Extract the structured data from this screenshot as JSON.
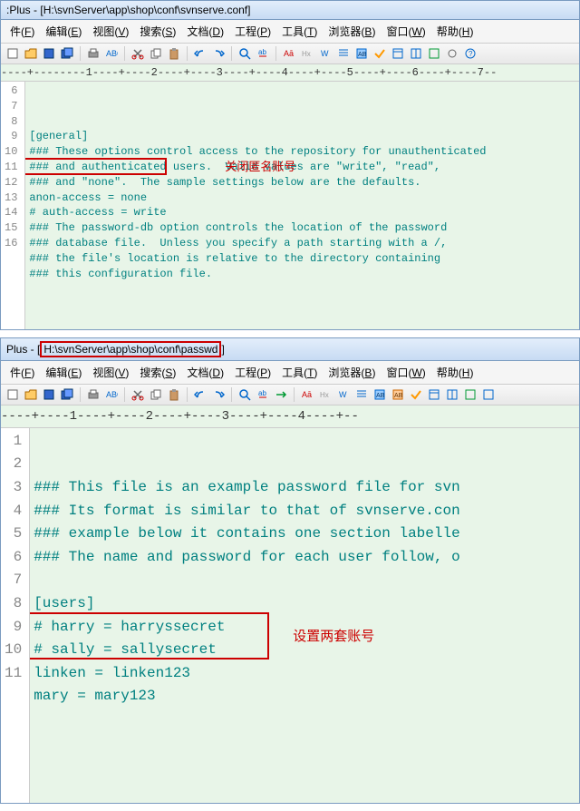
{
  "window1": {
    "title_prefix": ":Plus - [",
    "title_path": "H:\\svnServer\\app\\shop\\conf\\svnserve.conf",
    "title_suffix": "]",
    "menu": [
      {
        "label": "件",
        "u": "F"
      },
      {
        "label": "编辑",
        "u": "E"
      },
      {
        "label": "视图",
        "u": "V"
      },
      {
        "label": "搜索",
        "u": "S"
      },
      {
        "label": "文档",
        "u": "D"
      },
      {
        "label": "工程",
        "u": "P"
      },
      {
        "label": "工具",
        "u": "T"
      },
      {
        "label": "浏览器",
        "u": "B"
      },
      {
        "label": "窗口",
        "u": "W"
      },
      {
        "label": "帮助",
        "u": "H"
      }
    ],
    "ruler": "----+--------1----+----2----+----3----+----4----+----5----+----6----+----7--",
    "lines": [
      {
        "n": 6,
        "t": ""
      },
      {
        "n": 7,
        "t": "[general]"
      },
      {
        "n": 8,
        "t": "### These options control access to the repository for unauthenticated"
      },
      {
        "n": 9,
        "t": "### and authenticated users.  Valid values are \"write\", \"read\","
      },
      {
        "n": 10,
        "t": "### and \"none\".  The sample settings below are the defaults."
      },
      {
        "n": 11,
        "t": "anon-access = none"
      },
      {
        "n": 12,
        "t": "# auth-access = write"
      },
      {
        "n": 13,
        "t": "### The password-db option controls the location of the password"
      },
      {
        "n": 14,
        "t": "### database file.  Unless you specify a path starting with a /,"
      },
      {
        "n": 15,
        "t": "### the file's location is relative to the directory containing"
      },
      {
        "n": 16,
        "t": "### this configuration file."
      }
    ],
    "annotation": "关闭匿名账号"
  },
  "window2": {
    "title_prefix": "Plus - [",
    "title_path": "H:\\svnServer\\app\\shop\\conf\\passwd",
    "title_suffix": "]",
    "menu": [
      {
        "label": "件",
        "u": "F"
      },
      {
        "label": "编辑",
        "u": "E"
      },
      {
        "label": "视图",
        "u": "V"
      },
      {
        "label": "搜索",
        "u": "S"
      },
      {
        "label": "文档",
        "u": "D"
      },
      {
        "label": "工程",
        "u": "P"
      },
      {
        "label": "工具",
        "u": "T"
      },
      {
        "label": "浏览器",
        "u": "B"
      },
      {
        "label": "窗口",
        "u": "W"
      },
      {
        "label": "帮助",
        "u": "H"
      }
    ],
    "ruler": "----+----1----+----2----+----3----+----4----+--",
    "lines": [
      {
        "n": 1,
        "t": "### This file is an example password file for svn"
      },
      {
        "n": 2,
        "t": "### Its format is similar to that of svnserve.con"
      },
      {
        "n": 3,
        "t": "### example below it contains one section labelle"
      },
      {
        "n": 4,
        "t": "### The name and password for each user follow, o"
      },
      {
        "n": 5,
        "t": ""
      },
      {
        "n": 6,
        "t": "[users]"
      },
      {
        "n": 7,
        "t": "# harry = harryssecret"
      },
      {
        "n": 8,
        "t": "# sally = sallysecret"
      },
      {
        "n": 9,
        "t": "linken = linken123"
      },
      {
        "n": 10,
        "t": "mary = mary123"
      },
      {
        "n": 11,
        "t": ""
      }
    ],
    "annotation": "设置两套账号"
  }
}
